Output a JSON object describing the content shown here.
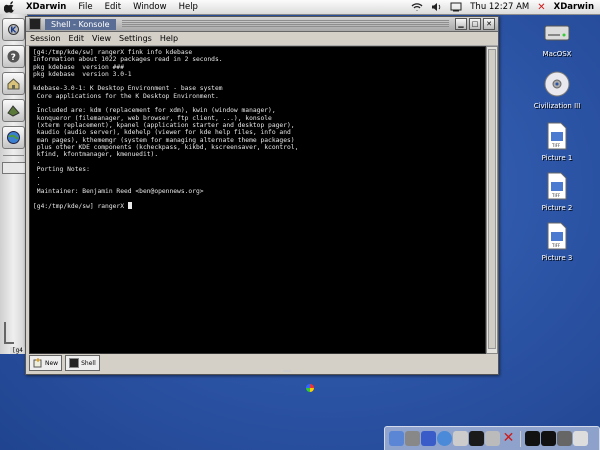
{
  "menubar": {
    "app": "XDarwin",
    "items": [
      "File",
      "Edit",
      "Window",
      "Help"
    ],
    "clock": "Thu 12:27 AM",
    "right_app": "XDarwin"
  },
  "panel": {
    "label_g4": "[g4"
  },
  "window": {
    "title": "Shell - Konsole",
    "menu": [
      "Session",
      "Edit",
      "View",
      "Settings",
      "Help"
    ],
    "terminal_lines": [
      "[g4:/tmp/kde/sw] rangerX fink info kdebase",
      "Information about 1022 packages read in 2 seconds.",
      "pkg kdebase  version ###",
      "pkg kdebase  version 3.0-1",
      "",
      "kdebase-3.0-1: K Desktop Environment - base system",
      " Core applications for the K Desktop Environment.",
      " .",
      " Included are: kdm (replacement for xdm), kwin (window manager),",
      " konqueror (filemanager, web browser, ftp client, ...), konsole",
      " (xterm replacement), kpanel (application starter and desktop pager),",
      " kaudio (audio server), kdehelp (viewer for kde help files, info and",
      " man pages), kthememgr (system for managing alternate theme packages)",
      " plus other KDE components (kcheckpass, kikbd, kscreensaver, kcontrol,",
      " kfind, kfontmanager, kmenuedit).",
      " .",
      " Porting Notes:",
      " .",
      " .",
      " Maintainer: Benjamin Reed <ben@opennews.org>",
      "",
      "[g4:/tmp/kde/sw] rangerX "
    ],
    "tabs": {
      "new_label": "New",
      "shell_label": "Shell"
    }
  },
  "desktop_icons": [
    {
      "label": "MacOSX",
      "icon": "hard-drive-icon"
    },
    {
      "label": "Civilization III",
      "icon": "cd-icon"
    },
    {
      "label": "Picture 1",
      "icon": "tiff-document-icon"
    },
    {
      "label": "Picture 2",
      "icon": "tiff-document-icon"
    },
    {
      "label": "Picture 3",
      "icon": "tiff-document-icon"
    }
  ],
  "colors": {
    "desktop": "#2b53a4",
    "terminal_bg": "#000000",
    "terminal_fg": "#e8e8e8",
    "title_active": "#5a6e95",
    "x_red": "#d01a1a"
  }
}
